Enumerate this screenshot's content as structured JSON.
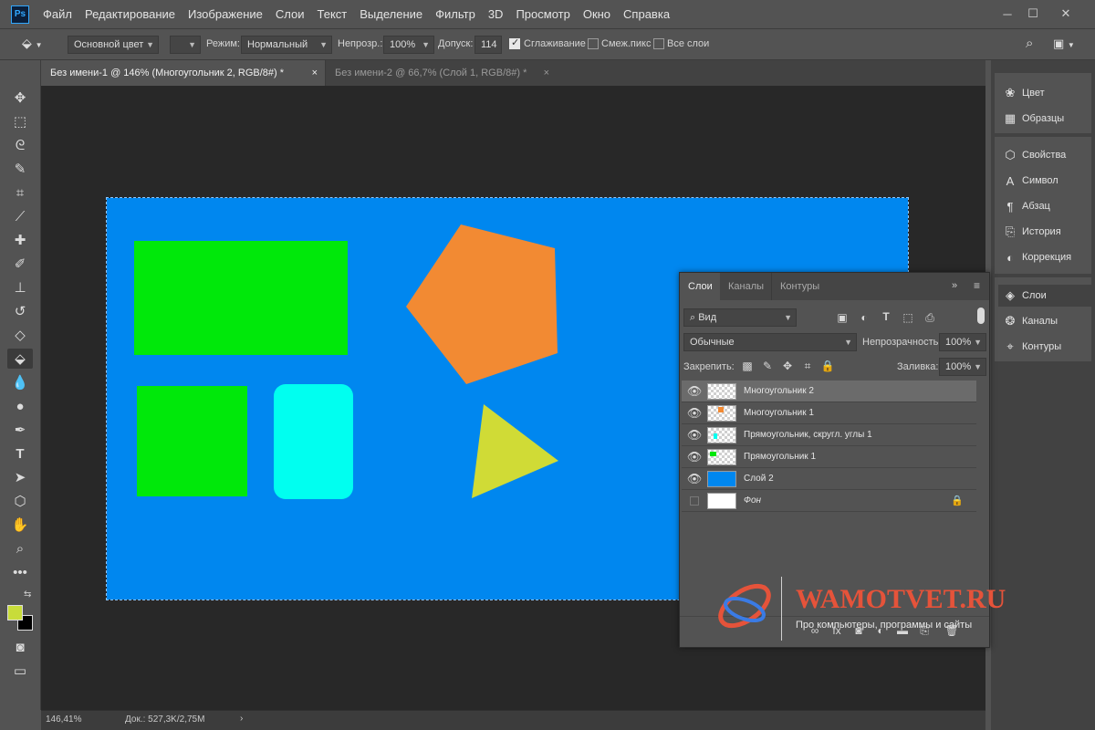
{
  "app": {
    "logo": "Ps"
  },
  "menu": [
    "Файл",
    "Редактирование",
    "Изображение",
    "Слои",
    "Текст",
    "Выделение",
    "Фильтр",
    "3D",
    "Просмотр",
    "Окно",
    "Справка"
  ],
  "options": {
    "fill_source": "Основной цвет",
    "mode_label": "Режим:",
    "mode_value": "Нормальный",
    "opacity_label": "Непрозр.:",
    "opacity_value": "100%",
    "tolerance_label": "Допуск:",
    "tolerance_value": "114",
    "antialias_label": "Сглаживание",
    "antialias_checked": true,
    "contiguous_label": "Смеж.пикс",
    "contiguous_checked": false,
    "all_layers_label": "Все слои",
    "all_layers_checked": false
  },
  "tabs": [
    {
      "label": "Без имени-1 @ 146% (Многоугольник 2, RGB/8#) *",
      "active": true
    },
    {
      "label": "Без имени-2 @ 66,7% (Слой 1, RGB/8#) *",
      "active": false
    }
  ],
  "colors": {
    "foreground": "#c8dc3a",
    "background": "#000000",
    "canvas_bg": "#0087ef",
    "rect1": "#00e80a",
    "rect2": "#00e80a",
    "rounded_rect": "#00fff0",
    "pentagon": "#f28a33",
    "triangle": "#d0db36"
  },
  "dock": {
    "group1": [
      {
        "icon": "palette-icon",
        "label": "Цвет"
      },
      {
        "icon": "grid-icon",
        "label": "Образцы"
      }
    ],
    "group2": [
      {
        "icon": "cube-icon",
        "label": "Свойства"
      },
      {
        "icon": "type-icon",
        "label": "Символ"
      },
      {
        "icon": "pilcrow-icon",
        "label": "Абзац"
      },
      {
        "icon": "history-icon",
        "label": "История"
      },
      {
        "icon": "adjust-icon",
        "label": "Коррекция"
      }
    ],
    "group3": [
      {
        "icon": "layers-icon",
        "label": "Слои",
        "active": true
      },
      {
        "icon": "channels-icon",
        "label": "Каналы"
      },
      {
        "icon": "paths-icon",
        "label": "Контуры"
      }
    ]
  },
  "layers_panel": {
    "tabs": [
      "Слои",
      "Каналы",
      "Контуры"
    ],
    "filter_value": "Вид",
    "blend_mode": "Обычные",
    "opacity_label": "Непрозрачность:",
    "opacity_value": "100%",
    "lock_label": "Закрепить:",
    "fill_label": "Заливка:",
    "fill_value": "100%",
    "layers": [
      {
        "name": "Многоугольник 2",
        "visible": true,
        "selected": true,
        "italic": false,
        "locked": false
      },
      {
        "name": "Многоугольник 1",
        "visible": true,
        "selected": false,
        "italic": false,
        "locked": false
      },
      {
        "name": "Прямоугольник, скругл. углы 1",
        "visible": true,
        "selected": false,
        "italic": false,
        "locked": false
      },
      {
        "name": "Прямоугольник 1",
        "visible": true,
        "selected": false,
        "italic": false,
        "locked": false
      },
      {
        "name": "Слой 2",
        "visible": true,
        "selected": false,
        "italic": false,
        "locked": false
      },
      {
        "name": "Фон",
        "visible": false,
        "selected": false,
        "italic": true,
        "locked": true
      }
    ]
  },
  "status": {
    "zoom": "146,41%",
    "doc": "Док.: 527,3K/2,75M"
  },
  "watermark": {
    "title": "WAMOTVET.RU",
    "subtitle": "Про компьютеры, программы и сайты"
  }
}
